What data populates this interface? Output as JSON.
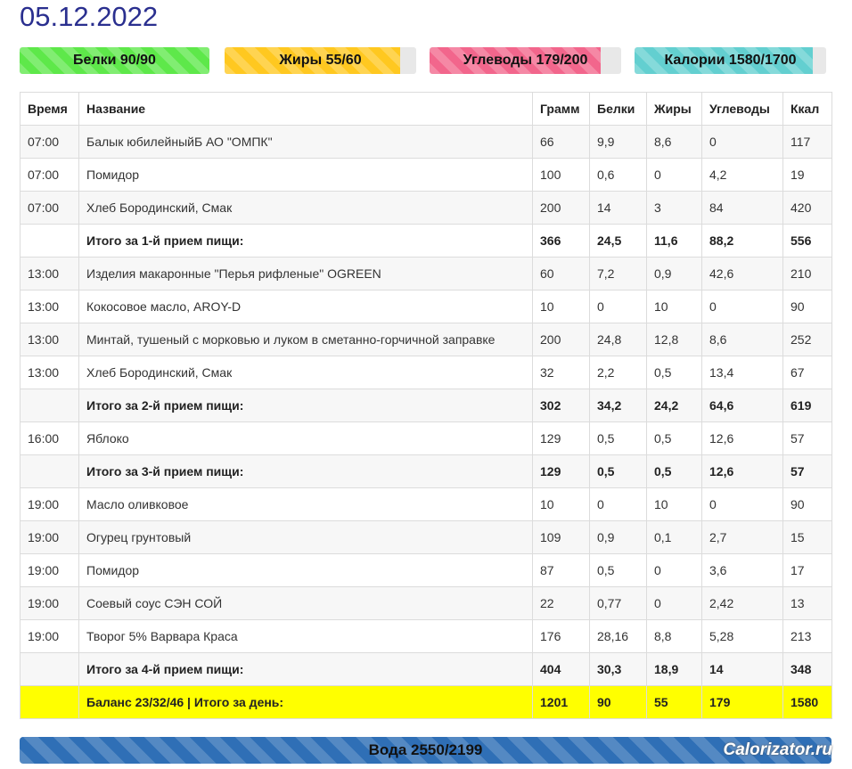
{
  "date": "05.12.2022",
  "colors": {
    "protein": "#5ee84a",
    "fat": "#ffc820",
    "carb": "#f2668c",
    "kcal": "#63cfd0",
    "water": "#2f6fb6",
    "grand_row": "#ffff00"
  },
  "bars": [
    {
      "id": "protein",
      "label": "Белки 90/90",
      "fill_fraction": 1.0
    },
    {
      "id": "fat",
      "label": "Жиры 55/60",
      "fill_fraction": 0.917
    },
    {
      "id": "carb",
      "label": "Углеводы 179/200",
      "fill_fraction": 0.895
    },
    {
      "id": "kcal",
      "label": "Калории 1580/1700",
      "fill_fraction": 0.929
    }
  ],
  "table": {
    "headers": [
      "Время",
      "Название",
      "Грамм",
      "Белки",
      "Жиры",
      "Углеводы",
      "Ккал"
    ],
    "rows": [
      {
        "type": "item",
        "time": "07:00",
        "name": "Балык юбилейныйБ АО \"ОМПК\"",
        "grams": "66",
        "protein": "9,9",
        "fat": "8,6",
        "carbs": "0",
        "kcal": "117"
      },
      {
        "type": "item",
        "time": "07:00",
        "name": "Помидор",
        "grams": "100",
        "protein": "0,6",
        "fat": "0",
        "carbs": "4,2",
        "kcal": "19"
      },
      {
        "type": "item",
        "time": "07:00",
        "name": "Хлеб Бородинский, Смак",
        "grams": "200",
        "protein": "14",
        "fat": "3",
        "carbs": "84",
        "kcal": "420"
      },
      {
        "type": "total",
        "time": "",
        "name": "Итого за 1-й прием пищи:",
        "grams": "366",
        "protein": "24,5",
        "fat": "11,6",
        "carbs": "88,2",
        "kcal": "556"
      },
      {
        "type": "item",
        "time": "13:00",
        "name": "Изделия макаронные \"Перья рифленые\" OGREEN",
        "grams": "60",
        "protein": "7,2",
        "fat": "0,9",
        "carbs": "42,6",
        "kcal": "210"
      },
      {
        "type": "item",
        "time": "13:00",
        "name": "Кокосовое масло, AROY-D",
        "grams": "10",
        "protein": "0",
        "fat": "10",
        "carbs": "0",
        "kcal": "90"
      },
      {
        "type": "item",
        "time": "13:00",
        "name": "Минтай, тушеный с морковью и луком в сметанно-горчичной заправке",
        "grams": "200",
        "protein": "24,8",
        "fat": "12,8",
        "carbs": "8,6",
        "kcal": "252"
      },
      {
        "type": "item",
        "time": "13:00",
        "name": "Хлеб Бородинский, Смак",
        "grams": "32",
        "protein": "2,2",
        "fat": "0,5",
        "carbs": "13,4",
        "kcal": "67"
      },
      {
        "type": "total",
        "time": "",
        "name": "Итого за 2-й прием пищи:",
        "grams": "302",
        "protein": "34,2",
        "fat": "24,2",
        "carbs": "64,6",
        "kcal": "619"
      },
      {
        "type": "item",
        "time": "16:00",
        "name": "Яблоко",
        "grams": "129",
        "protein": "0,5",
        "fat": "0,5",
        "carbs": "12,6",
        "kcal": "57"
      },
      {
        "type": "total",
        "time": "",
        "name": "Итого за 3-й прием пищи:",
        "grams": "129",
        "protein": "0,5",
        "fat": "0,5",
        "carbs": "12,6",
        "kcal": "57"
      },
      {
        "type": "item",
        "time": "19:00",
        "name": "Масло оливковое",
        "grams": "10",
        "protein": "0",
        "fat": "10",
        "carbs": "0",
        "kcal": "90"
      },
      {
        "type": "item",
        "time": "19:00",
        "name": "Огурец грунтовый",
        "grams": "109",
        "protein": "0,9",
        "fat": "0,1",
        "carbs": "2,7",
        "kcal": "15"
      },
      {
        "type": "item",
        "time": "19:00",
        "name": "Помидор",
        "grams": "87",
        "protein": "0,5",
        "fat": "0",
        "carbs": "3,6",
        "kcal": "17"
      },
      {
        "type": "item",
        "time": "19:00",
        "name": "Соевый соус СЭН СОЙ",
        "grams": "22",
        "protein": "0,77",
        "fat": "0",
        "carbs": "2,42",
        "kcal": "13"
      },
      {
        "type": "item",
        "time": "19:00",
        "name": "Творог 5% Варвара Краса",
        "grams": "176",
        "protein": "28,16",
        "fat": "8,8",
        "carbs": "5,28",
        "kcal": "213"
      },
      {
        "type": "total",
        "time": "",
        "name": "Итого за 4-й прием пищи:",
        "grams": "404",
        "protein": "30,3",
        "fat": "18,9",
        "carbs": "14",
        "kcal": "348"
      },
      {
        "type": "grand",
        "time": "",
        "name": "Баланс 23/32/46 | Итого за день:",
        "grams": "1201",
        "protein": "90",
        "fat": "55",
        "carbs": "179",
        "kcal": "1580"
      }
    ]
  },
  "water": {
    "label": "Вода 2550/2199",
    "fill_fraction": 1.0
  },
  "watermark": "Calorizator.ru"
}
